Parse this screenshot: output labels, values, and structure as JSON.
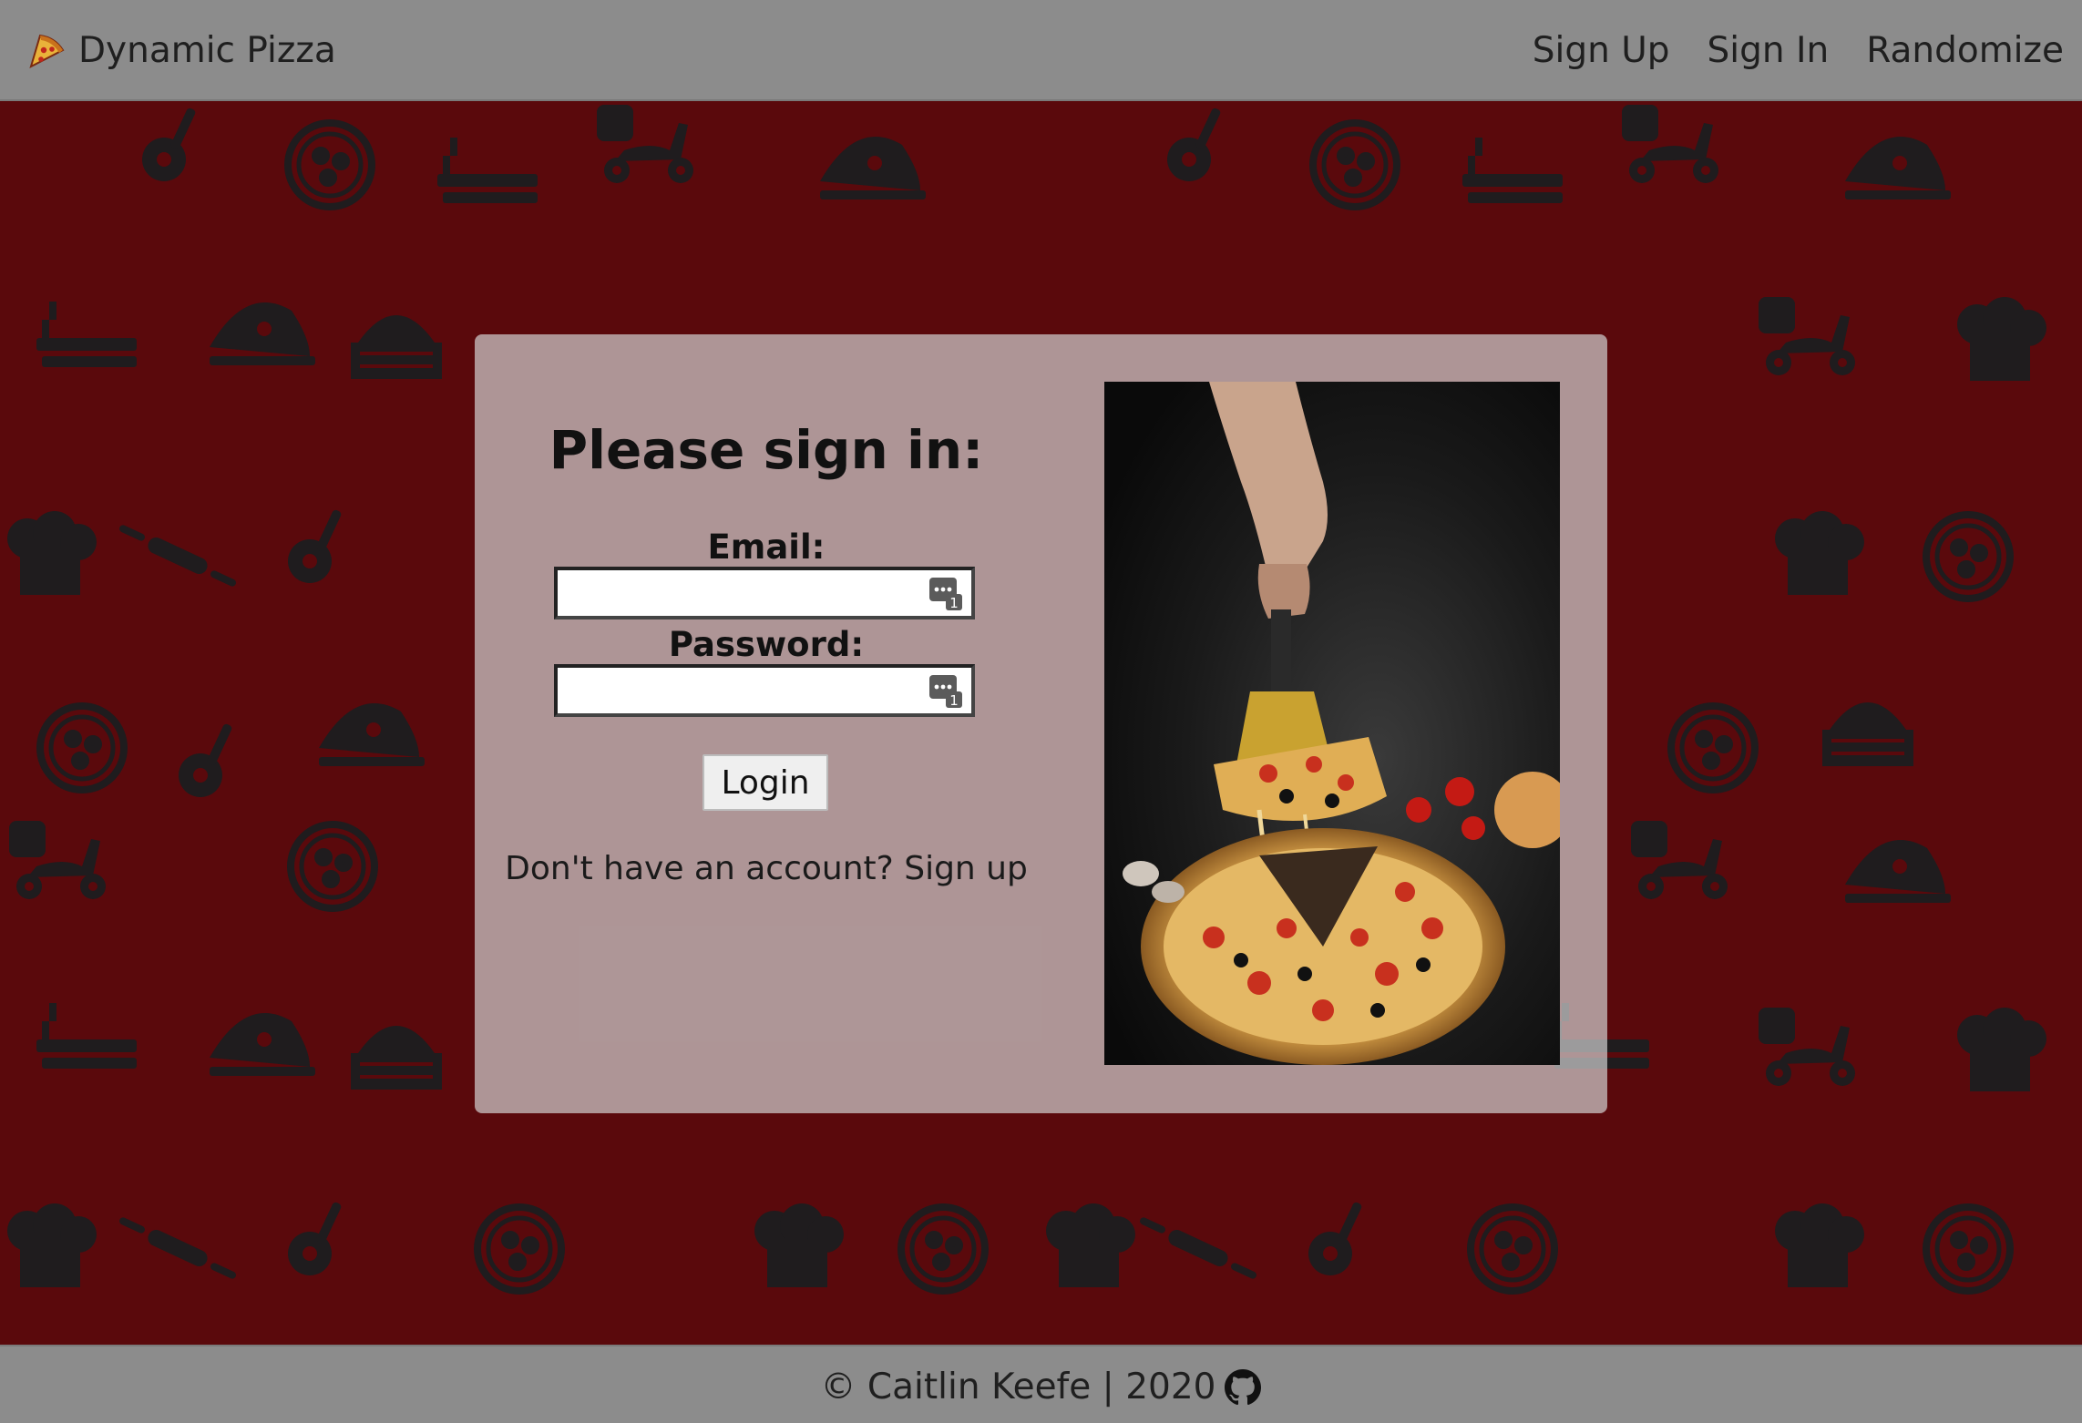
{
  "navbar": {
    "brand": "Dynamic Pizza",
    "links": [
      "Sign Up",
      "Sign In",
      "Randomize"
    ]
  },
  "form": {
    "title": "Please sign in:",
    "email_label": "Email:",
    "password_label": "Password:",
    "email_value": "",
    "password_value": "",
    "login_label": "Login",
    "signup_prompt": "Don't have an account?",
    "signup_link": "Sign up"
  },
  "footer": {
    "text": "© Caitlin Keefe | 2020"
  },
  "icons": {
    "brand": "pizza-slice-icon",
    "password_manager": "password-manager-icon",
    "footer_link": "github-icon"
  },
  "colors": {
    "background": "#5a090c",
    "pattern": "#1f1c1e",
    "navbar": "#8c8c8c",
    "card": "#d2d2d2"
  }
}
